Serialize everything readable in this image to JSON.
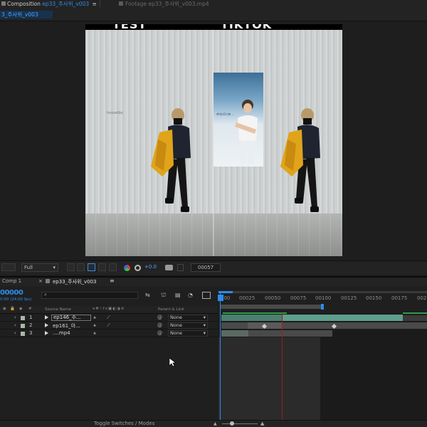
{
  "top_tabs": {
    "composition_prefix": "Composition",
    "composition_name": "ep33_주사위_v003",
    "footage_label": "Footage ep33_주사위_v003.mp4"
  },
  "comp_tab": "3_주사위_v003",
  "frame_title": {
    "left": "TEST",
    "right": "TIKTOK"
  },
  "wall_mark": "hoozelbo",
  "poster_text": "#미녀1기초 ...",
  "viewer_footer": {
    "resolution": "Full",
    "exposure": "+0.0",
    "frame": "00057"
  },
  "timeline": {
    "panel_tab": "Comp 1",
    "active_tab": "ep33_주사위_v003",
    "timecode": "00000",
    "fps": "0:00 (24.00 fps)",
    "col_source_name": "Source Name",
    "col_parent": "Parent & Link",
    "ruler_ticks": [
      "00025",
      "00050",
      "00075",
      "00100",
      "00125",
      "00150",
      "00175",
      "002"
    ],
    "ruler_start": "000",
    "layers": [
      {
        "index": "1",
        "name": "ep146_주...",
        "parent": "None"
      },
      {
        "index": "2",
        "name": "ep161_아...",
        "parent": "None"
      },
      {
        "index": "3",
        "name": "....mp4",
        "parent": "None"
      }
    ]
  },
  "bottom": {
    "toggle_label": "Toggle Switches / Modes"
  },
  "colors": {
    "accent_blue": "#2d8ceb",
    "playhead_red": "#a31a1a",
    "track_teal": "#5f9e8c",
    "work_area_green": "#2f9e4a"
  }
}
